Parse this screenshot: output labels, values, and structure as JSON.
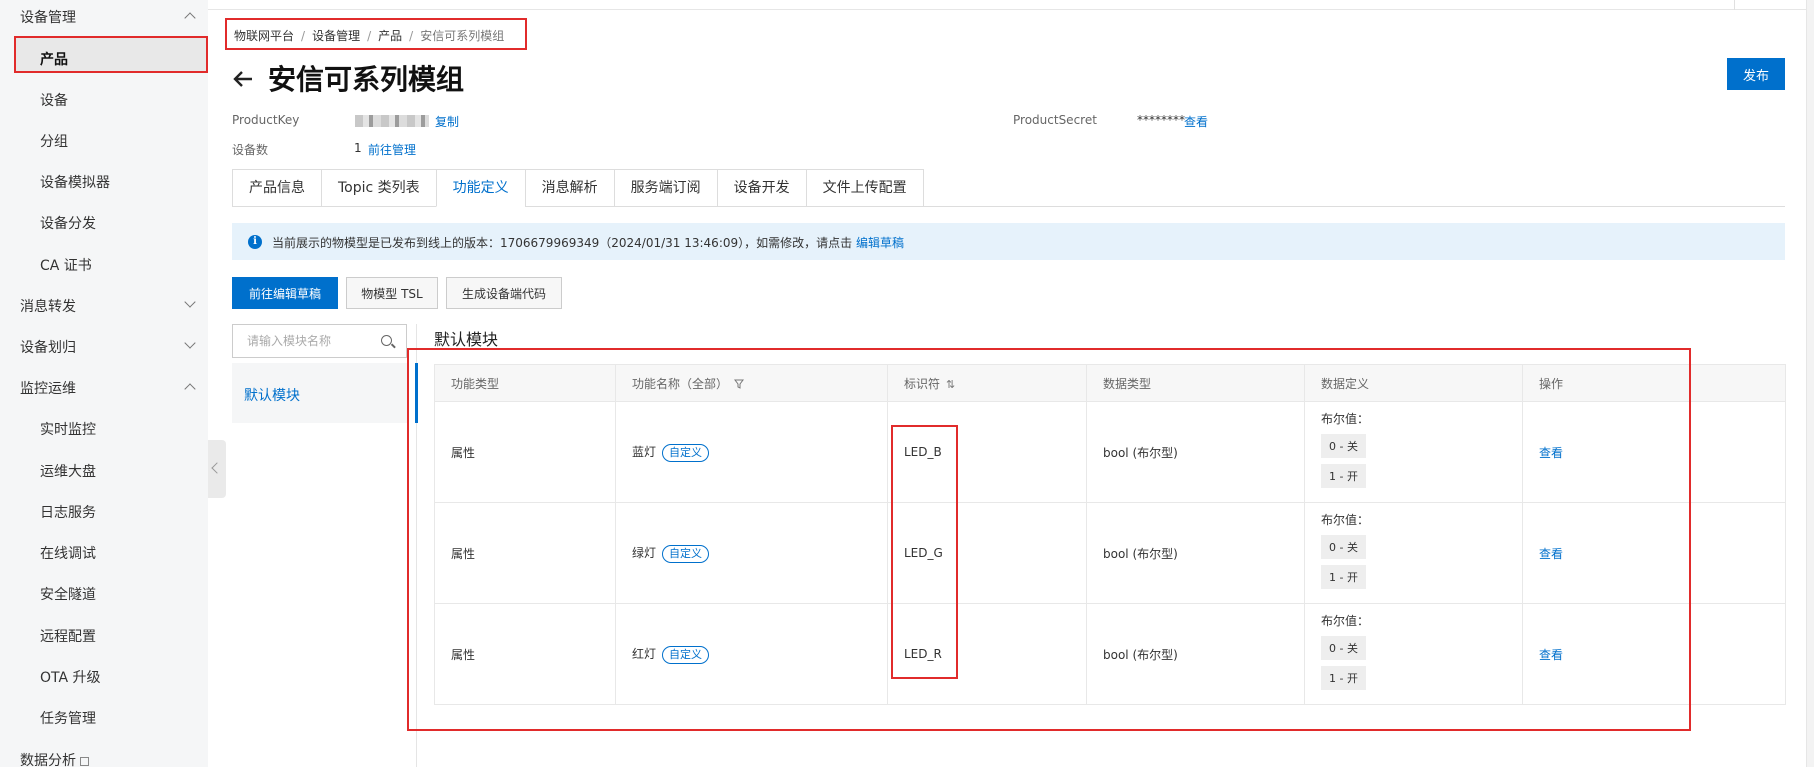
{
  "sidebar": {
    "group_device": "设备管理",
    "items_device": [
      "产品",
      "设备",
      "分组",
      "设备模拟器",
      "设备分发",
      "CA 证书"
    ],
    "group_message": "消息转发",
    "group_assign": "设备划归",
    "group_ops": "监控运维",
    "items_ops": [
      "实时监控",
      "运维大盘",
      "日志服务",
      "在线调试",
      "安全隧道",
      "远程配置",
      "OTA 升级",
      "任务管理"
    ],
    "group_analytics": "数据分析"
  },
  "breadcrumb": {
    "items": [
      "物联网平台",
      "设备管理",
      "产品"
    ],
    "current": "安信可系列模组"
  },
  "header": {
    "title": "安信可系列模组",
    "publish_label": "发布"
  },
  "meta": {
    "product_key_label": "ProductKey",
    "copy_label": "复制",
    "product_secret_label": "ProductSecret",
    "product_secret_value": "********",
    "view_label": "查看",
    "device_count_label": "设备数",
    "device_count_value": "1",
    "manage_link": "前往管理"
  },
  "tabs": [
    "产品信息",
    "Topic 类列表",
    "功能定义",
    "消息解析",
    "服务端订阅",
    "设备开发",
    "文件上传配置"
  ],
  "active_tab": "功能定义",
  "notice": {
    "text": "当前展示的物模型是已发布到线上的版本：1706679969349（2024/01/31 13:46:09），如需修改，请点击",
    "link": "编辑草稿"
  },
  "actions": {
    "edit_draft": "前往编辑草稿",
    "tsl": "物模型 TSL",
    "gen_code": "生成设备端代码"
  },
  "modules": {
    "search_placeholder": "请输入模块名称",
    "items": [
      "默认模块"
    ],
    "section_title": "默认模块"
  },
  "table": {
    "headers": [
      "功能类型",
      "功能名称（全部）",
      "标识符",
      "数据类型",
      "数据定义",
      "操作"
    ],
    "rows": [
      {
        "type": "属性",
        "name": "蓝灯",
        "tag": "自定义",
        "identifier": "LED_B",
        "data_type": "bool (布尔型)",
        "def_label": "布尔值：",
        "def_0": "0 - 关",
        "def_1": "1 - 开",
        "action": "查看"
      },
      {
        "type": "属性",
        "name": "绿灯",
        "tag": "自定义",
        "identifier": "LED_G",
        "data_type": "bool (布尔型)",
        "def_label": "布尔值：",
        "def_0": "0 - 关",
        "def_1": "1 - 开",
        "action": "查看"
      },
      {
        "type": "属性",
        "name": "红灯",
        "tag": "自定义",
        "identifier": "LED_R",
        "data_type": "bool (布尔型)",
        "def_label": "布尔值：",
        "def_0": "0 - 关",
        "def_1": "1 - 开",
        "action": "查看"
      }
    ]
  },
  "colors": {
    "primary": "#0070cc",
    "highlight_border": "#e12b2b",
    "brand_orange": "#ff6a00"
  }
}
